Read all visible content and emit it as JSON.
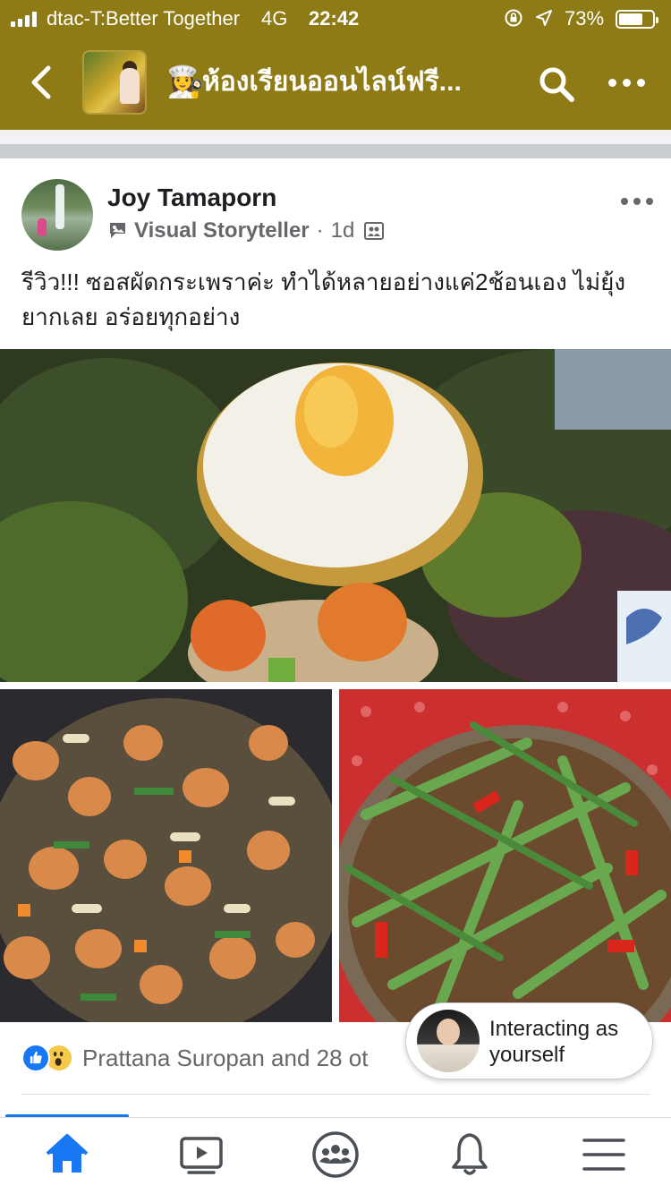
{
  "status_bar": {
    "carrier": "dtac-T:Better Together",
    "network": "4G",
    "time": "22:42",
    "battery_percent": "73%",
    "battery_level": 0.73,
    "icons": [
      "signal-bars-icon",
      "orientation-lock-icon",
      "location-arrow-icon",
      "battery-icon"
    ]
  },
  "header": {
    "chef_emoji": "👩‍🍳",
    "title": "ห้องเรียนออนไลน์ฟรี...",
    "icons": [
      "back-arrow-icon",
      "search-icon",
      "more-dots-icon"
    ]
  },
  "post": {
    "author": "Joy Tamaporn",
    "badge": "Visual Storyteller",
    "separator": "·",
    "time": "1d",
    "text": "รีวิว!!! ซอสผัดกระเพราค่ะ ทำได้หลายอย่างแค่2ช้อนเอง ไม่ยุ้งยากเลย อร่อยทุกอย่าง",
    "reactions_summary": "Prattana Suropan and 28 ot",
    "reaction_icons": [
      "like-reaction-icon",
      "wow-reaction-icon"
    ]
  },
  "interacting_as": {
    "line1": "Interacting as",
    "line2": "yourself"
  },
  "tab_bar": {
    "tabs": [
      "home-icon",
      "watch-icon",
      "groups-icon",
      "notifications-icon",
      "menu-icon"
    ],
    "active": "home-icon"
  },
  "colors": {
    "header_bg": "#8f7b15",
    "accent": "#1877f2",
    "secondary_text": "#65676b"
  }
}
